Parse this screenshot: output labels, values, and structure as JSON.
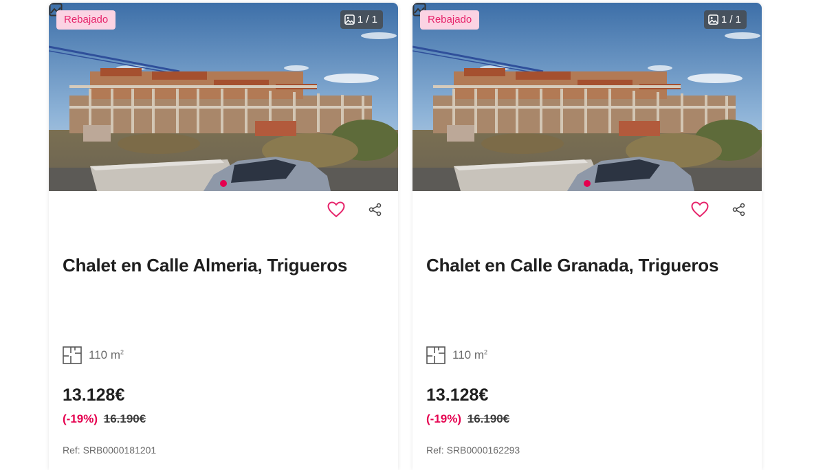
{
  "colors": {
    "accent": "#e5004f",
    "badge_bg": "#fbd3e3",
    "badge_text": "#e6246b",
    "heart": "#e6246b"
  },
  "listings": [
    {
      "badge": "Rebajado",
      "image_counter": "1 / 1",
      "title": "Chalet en Calle Almeria, Trigueros",
      "surface_value": "110 m",
      "surface_unit_sup": "2",
      "price": "13.128€",
      "discount": "(-19%)",
      "old_price": "16.190€",
      "ref": "Ref: SRB0000181201"
    },
    {
      "badge": "Rebajado",
      "image_counter": "1 / 1",
      "title": "Chalet en Calle Granada, Trigueros",
      "surface_value": "110 m",
      "surface_unit_sup": "2",
      "price": "13.128€",
      "discount": "(-19%)",
      "old_price": "16.190€",
      "ref": "Ref: SRB0000162293"
    }
  ],
  "icons": {
    "favorite": "heart-outline-icon",
    "share": "share-icon",
    "gallery": "image-icon",
    "floorplan": "floor-plan-icon",
    "broken_image": "broken-image-icon"
  }
}
